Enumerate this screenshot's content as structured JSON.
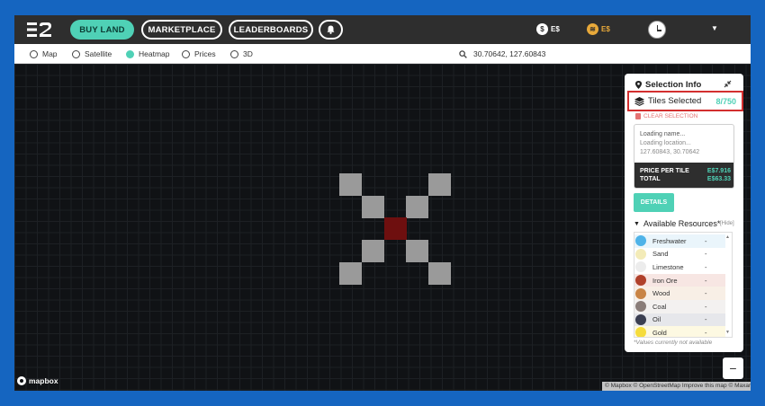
{
  "nav": {
    "buy_land": "BUY LAND",
    "marketplace": "MARKETPLACE",
    "leaderboards": "LEADERBOARDS",
    "currency_1": "E$",
    "currency_2": "E$"
  },
  "map_modes": {
    "items": [
      "Map",
      "Satellite",
      "Heatmap",
      "Prices",
      "3D"
    ],
    "selected": "Heatmap"
  },
  "search": {
    "coords": "30.70642, 127.60843"
  },
  "map": {
    "logo": "mapbox",
    "attribution": "© Mapbox © OpenStreetMap Improve this map © Maxar",
    "zoom_out": "−"
  },
  "panel": {
    "title": "Selection Info",
    "tiles_label": "Tiles Selected",
    "tiles_count": "8/750",
    "clear": "CLEAR SELECTION",
    "loading_name": "Loading name...",
    "loading_location": "Loading location...",
    "coords": "127.60843, 30.70642",
    "price_per_tile_label": "PRICE PER TILE",
    "price_per_tile": "E$7.916",
    "total_label": "TOTAL",
    "total": "E$63.33",
    "details": "DETAILS",
    "resources_title": "Available Resources*",
    "hide": "[Hide]",
    "note": "*Values currently not available"
  },
  "resources": [
    {
      "name": "Freshwater",
      "value": "-",
      "color": "#4fb3e8",
      "bg": "#eaf5fb"
    },
    {
      "name": "Sand",
      "value": "-",
      "color": "#f3ebb8",
      "bg": "#ffffff"
    },
    {
      "name": "Limestone",
      "value": "-",
      "color": "#ececec",
      "bg": "#ffffff"
    },
    {
      "name": "Iron Ore",
      "value": "-",
      "color": "#b0412b",
      "bg": "#f7e6e3"
    },
    {
      "name": "Wood",
      "value": "-",
      "color": "#c98445",
      "bg": "#f8efe6"
    },
    {
      "name": "Coal",
      "value": "-",
      "color": "#8a7d79",
      "bg": "#f3f1f0"
    },
    {
      "name": "Oil",
      "value": "-",
      "color": "#3b3f52",
      "bg": "#e6e7eb"
    },
    {
      "name": "Gold",
      "value": "-",
      "color": "#f5dc3c",
      "bg": "#fdf9e2"
    }
  ]
}
